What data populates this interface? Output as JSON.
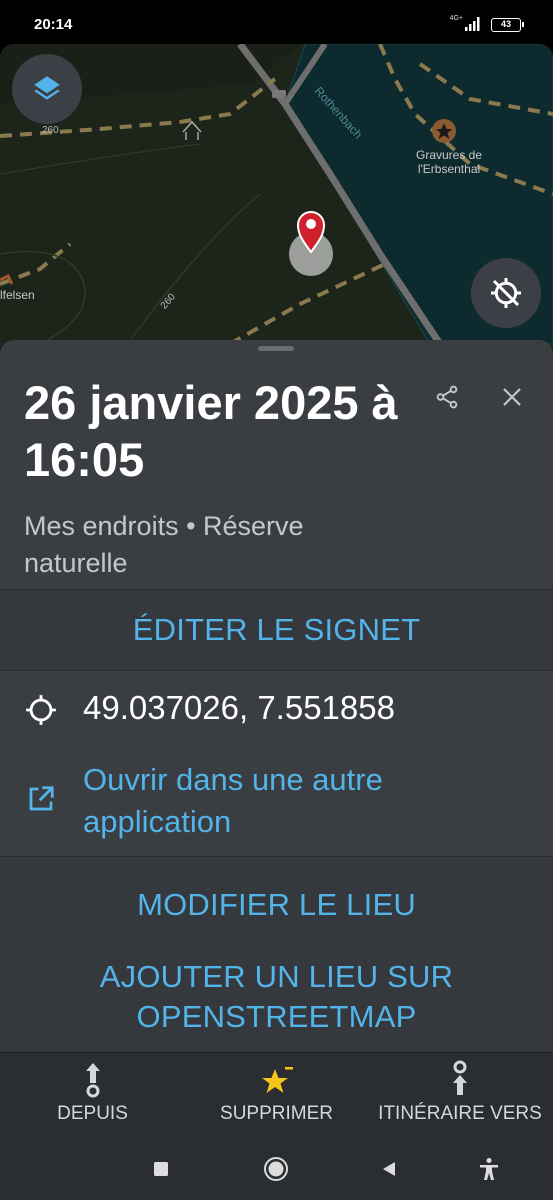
{
  "status_bar": {
    "time": "20:14",
    "network": "4G+",
    "battery": "43"
  },
  "map": {
    "labels": {
      "river": "Rothenbach",
      "poi": "Gravures de l'Erbsenthal",
      "place": "lfelsen",
      "elev_1": "260",
      "elev_2": "260"
    },
    "layers_icon": "layers-icon",
    "location_icon": "location-disabled-icon"
  },
  "sheet": {
    "title": "26 janvier 2025 à 16:05",
    "subtitle": "Mes endroits • Réserve naturelle",
    "edit_bookmark": "ÉDITER LE SIGNET",
    "coordinates": "49.037026, 7.551858",
    "open_in_app": "Ouvrir dans une autre application",
    "modify_place": "MODIFIER LE LIEU",
    "add_osm": "AJOUTER UN LIEU SUR OPENSTREETMAP"
  },
  "actions": {
    "from": "DEPUIS",
    "delete": "SUPPRIMER",
    "route_to": "ITINÉRAIRE VERS"
  },
  "colors": {
    "accent": "#52b4e8",
    "star": "#f5c518",
    "marker": "#d0202e"
  }
}
